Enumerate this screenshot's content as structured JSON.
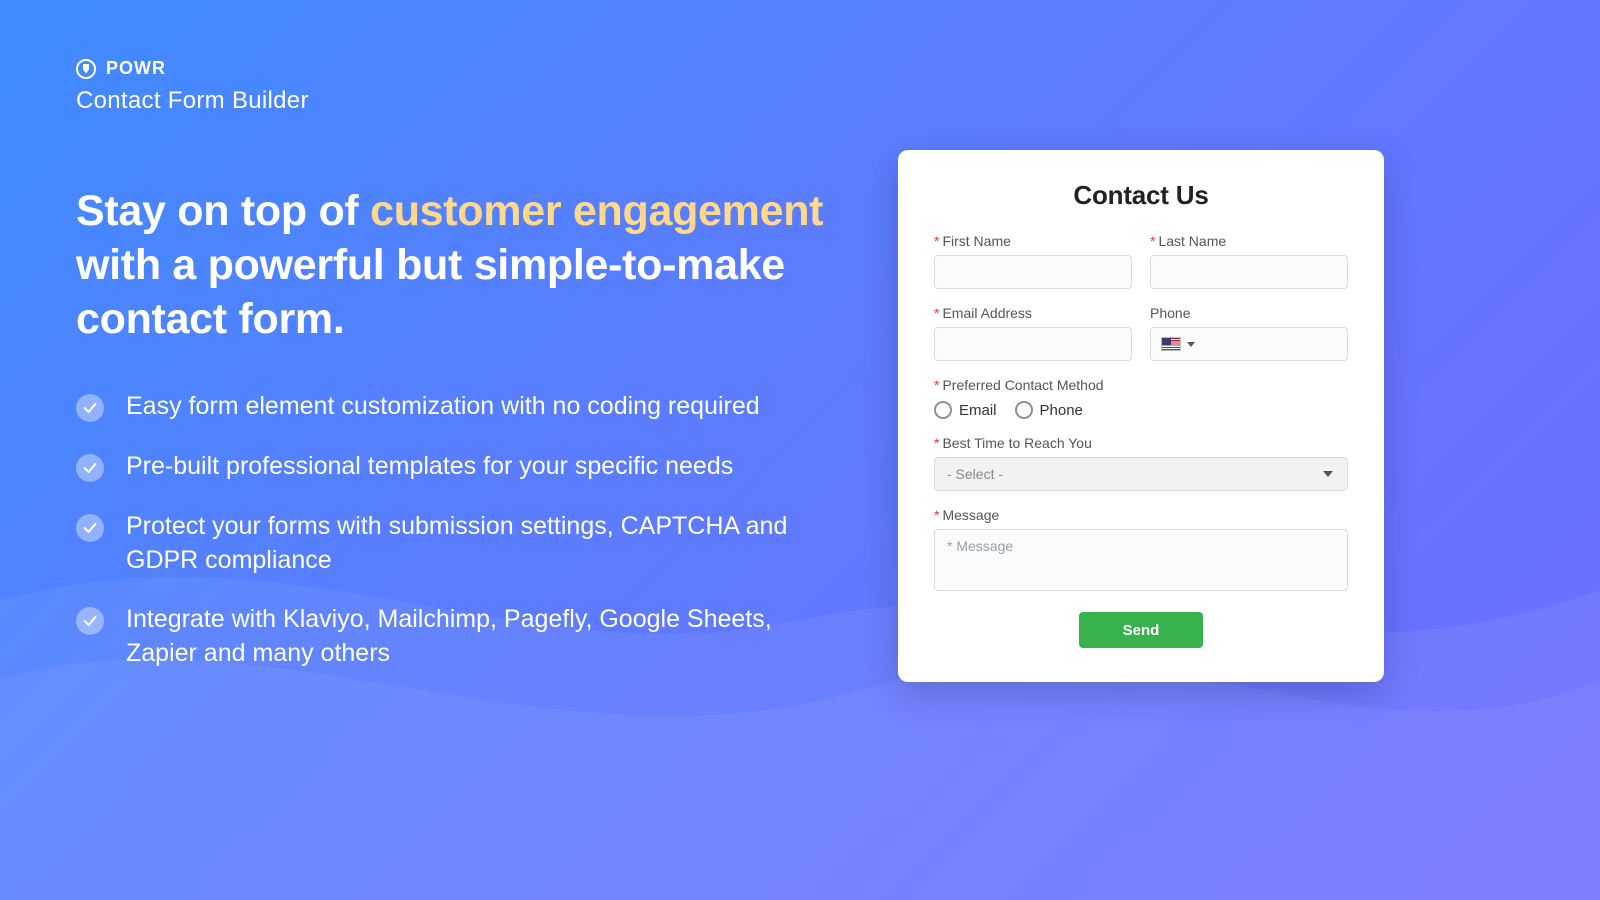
{
  "brand": {
    "name": "POWR",
    "product": "Contact Form Builder"
  },
  "hero": {
    "headline_pre": "Stay on top of ",
    "headline_accent": "customer engagement",
    "headline_post": " with a powerful but simple-to-make contact form."
  },
  "benefits": [
    "Easy form element customization with no coding required",
    "Pre-built professional templates for your specific needs",
    "Protect your forms with submission settings, CAPTCHA and GDPR compliance",
    "Integrate with Klaviyo, Mailchimp, Pagefly, Google Sheets, Zapier and many others"
  ],
  "form": {
    "title": "Contact Us",
    "fields": {
      "first_name": {
        "label": "First Name",
        "required": true
      },
      "last_name": {
        "label": "Last Name",
        "required": true
      },
      "email": {
        "label": "Email Address",
        "required": true
      },
      "phone": {
        "label": "Phone",
        "required": false
      },
      "method": {
        "label": "Preferred Contact Method",
        "required": true,
        "options": [
          "Email",
          "Phone"
        ]
      },
      "best_time": {
        "label": "Best Time to Reach You",
        "required": true,
        "placeholder": "- Select -"
      },
      "message": {
        "label": "Message",
        "required": true,
        "placeholder": "* Message"
      }
    },
    "submit_label": "Send",
    "required_marker": "*"
  },
  "colors": {
    "accent_text": "#ffd88a",
    "submit_bg": "#37b24d",
    "required": "#e23b3b"
  }
}
